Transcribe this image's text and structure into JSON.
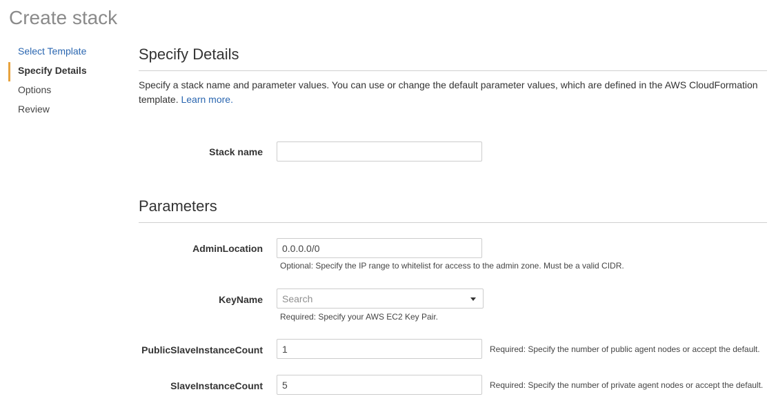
{
  "page_title": "Create stack",
  "sidebar": {
    "items": [
      {
        "label": "Select Template",
        "state": "link"
      },
      {
        "label": "Specify Details",
        "state": "active"
      },
      {
        "label": "Options",
        "state": "normal"
      },
      {
        "label": "Review",
        "state": "normal"
      }
    ]
  },
  "details": {
    "title": "Specify Details",
    "description": "Specify a stack name and parameter values. You can use or change the default parameter values, which are defined in the AWS CloudFormation template.",
    "learn_more": "Learn more.",
    "stack_name_label": "Stack name",
    "stack_name_value": ""
  },
  "parameters": {
    "title": "Parameters",
    "admin_location": {
      "label": "AdminLocation",
      "value": "0.0.0.0/0",
      "help": "Optional: Specify the IP range to whitelist for access to the admin zone. Must be a valid CIDR."
    },
    "key_name": {
      "label": "KeyName",
      "placeholder": "Search",
      "help": "Required: Specify your AWS EC2 Key Pair."
    },
    "public_slave_instance_count": {
      "label": "PublicSlaveInstanceCount",
      "value": "1",
      "help": "Required: Specify the number of public agent nodes or accept the default."
    },
    "slave_instance_count": {
      "label": "SlaveInstanceCount",
      "value": "5",
      "help": "Required: Specify the number of private agent nodes or accept the default."
    }
  },
  "colors": {
    "accent": "#e7a33e",
    "link": "#2a66b0",
    "title_gray": "#8a8a8a"
  }
}
